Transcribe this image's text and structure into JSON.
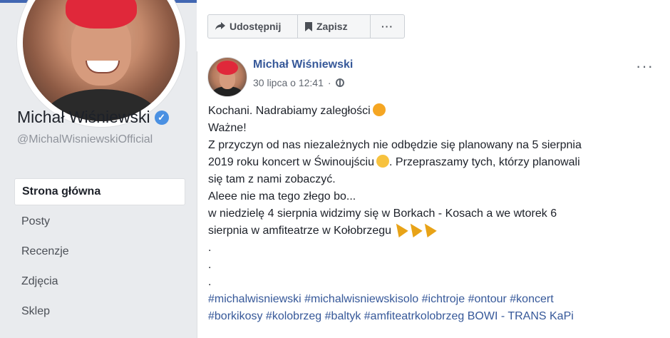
{
  "page": {
    "name": "Michał Wiśniewski",
    "handle": "@MichalWisniewskiOfficial"
  },
  "nav": {
    "items": [
      {
        "label": "Strona główna",
        "active": true
      },
      {
        "label": "Posty"
      },
      {
        "label": "Recenzje"
      },
      {
        "label": "Zdjęcia"
      },
      {
        "label": "Sklep"
      }
    ]
  },
  "actions": {
    "share_label": "Udostępnij",
    "save_label": "Zapisz",
    "more_label": "···"
  },
  "post": {
    "author": "Michał Wiśniewski",
    "timestamp": "30 lipca o 12:41",
    "menu": "···",
    "line1": "Kochani. Nadrabiamy zaległości",
    "line2": "Ważne!",
    "line3a": "Z przyczyn od nas niezależnych nie odbędzie się planowany na 5 sierpnia",
    "line3b": "2019 roku koncert w Świnoujściu",
    "line3c": ". Przepraszamy tych, którzy planowali",
    "line3d": "się tam z nami zobaczyć.",
    "line4": "Aleee nie ma tego złego bo...",
    "line5a": "w niedzielę 4 sierpnia widzimy się w Borkach - Kosach a we wtorek 6",
    "line5b": "sierpnia w amfiteatrze w Kołobrzegu",
    "dot": ".",
    "hashtags1": "#michalwisniewski #michalwisniewskisolo #ichtroje #ontour #koncert",
    "hashtags2": "#borkikosy #kolobrzeg #baltyk #amfiteatrkolobrzeg BOWI - TRANS KaPi"
  },
  "icons": {
    "share": "share-arrow-icon",
    "save": "bookmark-icon",
    "audience": "globe-icon",
    "verified": "verified-badge-icon"
  },
  "colors": {
    "link": "#365899",
    "verified": "#4a90e2",
    "background": "#e9ebee"
  }
}
